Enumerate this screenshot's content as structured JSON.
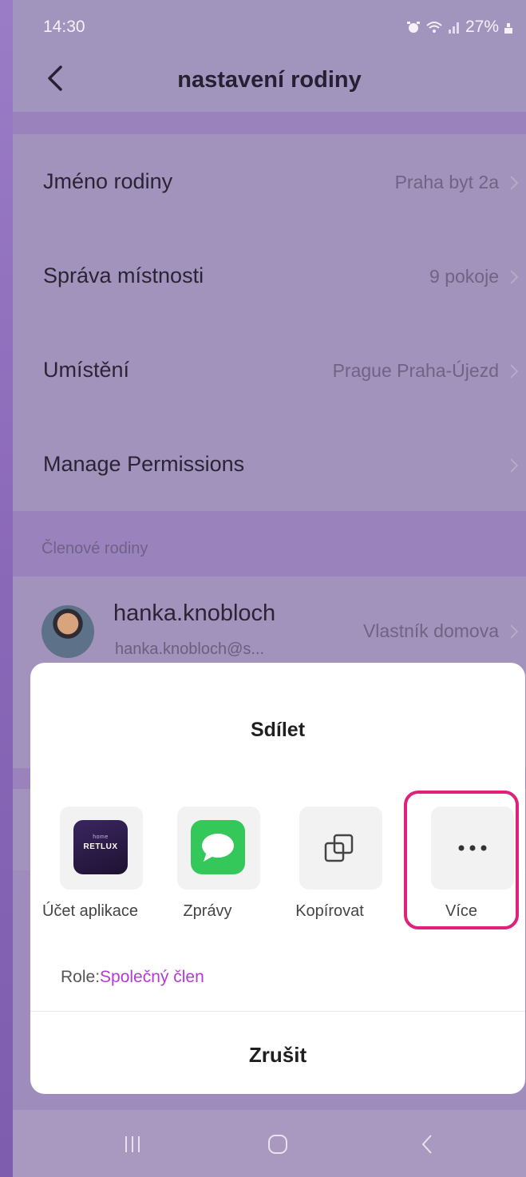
{
  "status": {
    "time": "14:30",
    "battery": "27%"
  },
  "header": {
    "title": "nastavení rodiny"
  },
  "settings": [
    {
      "label": "Jméno rodiny",
      "value": "Praha byt 2a"
    },
    {
      "label": "Správa místnosti",
      "value": "9 pokoje"
    },
    {
      "label": "Umístění",
      "value": "Prague Praha-Újezd"
    },
    {
      "label": "Manage Permissions",
      "value": ""
    }
  ],
  "members_section": {
    "title": "Členové rodiny"
  },
  "member": {
    "name": "hanka.knobloch",
    "email": "hanka.knobloch@s...",
    "role": "Vlastník domova"
  },
  "share_sheet": {
    "title": "Sdílet",
    "items": [
      {
        "label": "Účet aplikace",
        "icon": "retlux-app-icon"
      },
      {
        "label": "Zprávy",
        "icon": "messages-icon"
      },
      {
        "label": "Kopírovat",
        "icon": "copy-icon"
      },
      {
        "label": "Více",
        "icon": "more-icon"
      }
    ],
    "role_label": "Role:",
    "role_value": "Společný člen",
    "cancel": "Zrušit"
  },
  "retlux_logo": {
    "brand": "RETLUX",
    "sub": "home"
  },
  "colors": {
    "highlight": "#e0207a",
    "role_accent": "#b43ad6",
    "messages_green": "#34c759"
  }
}
